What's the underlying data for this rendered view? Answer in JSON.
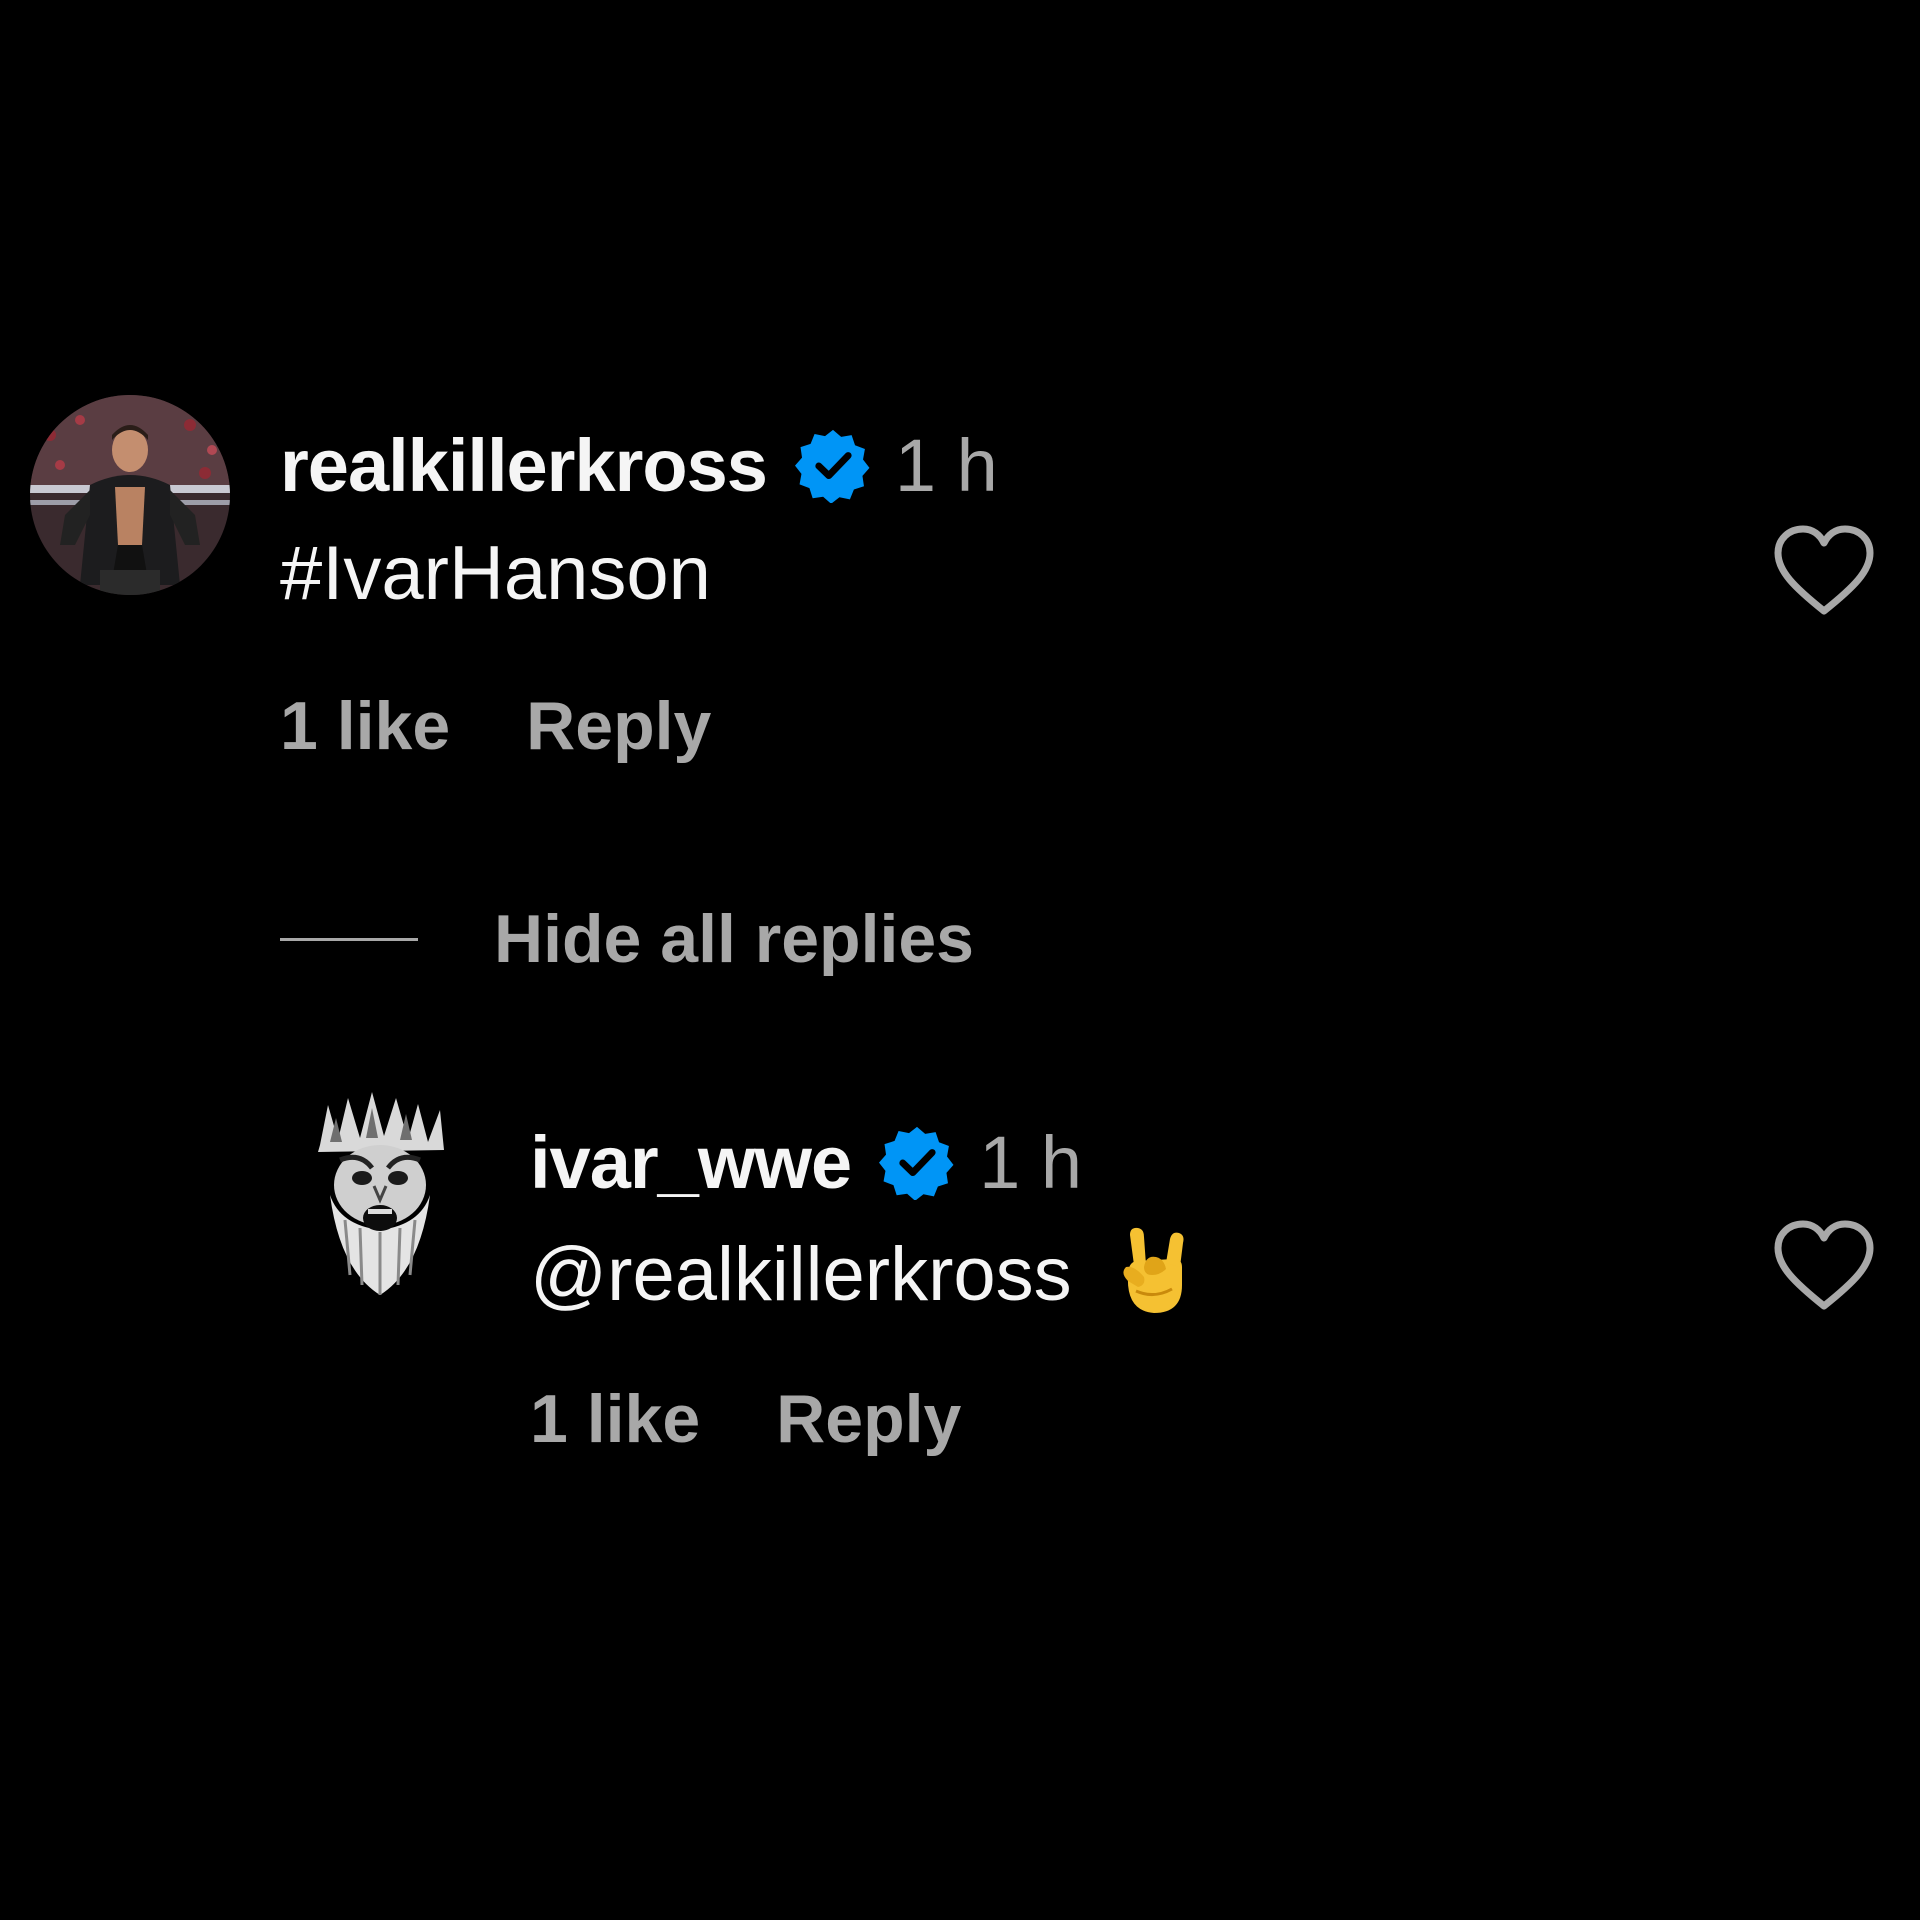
{
  "comments": [
    {
      "username": "realkillerkross",
      "verified": true,
      "time": "1 h",
      "text": "#IvarHanson",
      "likes": "1 like",
      "reply_label": "Reply",
      "avatar_icon": "wrestler-photo-avatar"
    }
  ],
  "thread": {
    "hide_replies_label": "Hide all replies"
  },
  "replies": [
    {
      "username": "ivar_wwe",
      "verified": true,
      "time": "1 h",
      "text": "@realkillerkross",
      "emoji": "rock-on-hand-emoji",
      "likes": "1 like",
      "reply_label": "Reply",
      "avatar_icon": "crowned-bearded-face-avatar"
    }
  ],
  "colors": {
    "background": "#000000",
    "primary_text": "#f5f5f5",
    "secondary_text": "#a8a8a8",
    "verified_badge": "#0095f6"
  }
}
